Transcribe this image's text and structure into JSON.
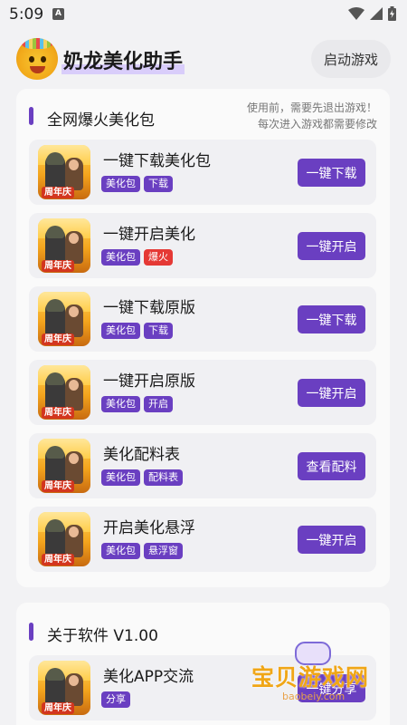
{
  "status": {
    "time": "5:09",
    "notification_icon": "A"
  },
  "header": {
    "title": "奶龙美化助手",
    "start_button": "启动游戏"
  },
  "section1": {
    "title": "全网爆火美化包",
    "notice_line1": "使用前，需要先退出游戏！",
    "notice_line2": "每次进入游戏都需要修改"
  },
  "items": [
    {
      "title": "一键下载美化包",
      "tags": [
        "美化包",
        "下载"
      ],
      "button": "一键下载",
      "thumb_badge": "周年庆"
    },
    {
      "title": "一键开启美化",
      "tags": [
        "美化包",
        "爆火"
      ],
      "button": "一键开启",
      "thumb_badge": "周年庆"
    },
    {
      "title": "一键下载原版",
      "tags": [
        "美化包",
        "下载"
      ],
      "button": "一键下载",
      "thumb_badge": "周年庆"
    },
    {
      "title": "一键开启原版",
      "tags": [
        "美化包",
        "开启"
      ],
      "button": "一键开启",
      "thumb_badge": "周年庆"
    },
    {
      "title": "美化配料表",
      "tags": [
        "美化包",
        "配料表"
      ],
      "button": "查看配料",
      "thumb_badge": "周年庆"
    },
    {
      "title": "开启美化悬浮",
      "tags": [
        "美化包",
        "悬浮窗"
      ],
      "button": "一键开启",
      "thumb_badge": "周年庆"
    }
  ],
  "section2": {
    "title": "关于软件 V1.00",
    "item": {
      "title": "美化APP交流",
      "tags": [
        "分享"
      ],
      "button": "一键分享",
      "thumb_badge": "周年庆"
    }
  },
  "watermark": {
    "text": "宝贝游戏网",
    "url": "baobeiy.com"
  },
  "colors": {
    "accent": "#6a3fc1",
    "hot_tag": "#e53935"
  }
}
